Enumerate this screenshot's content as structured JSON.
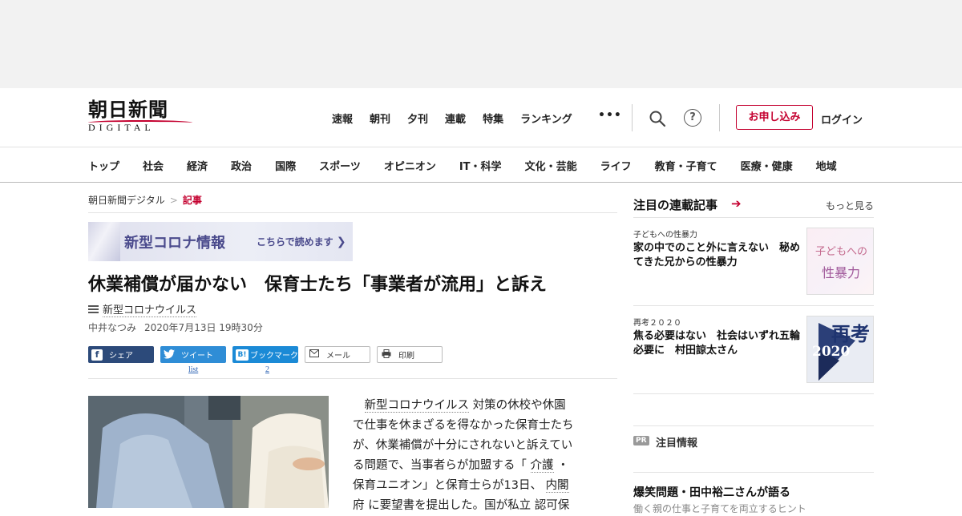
{
  "header": {
    "logo_main": "朝日新聞",
    "logo_sub": "DIGITAL",
    "nav": [
      "速報",
      "朝刊",
      "夕刊",
      "連載",
      "特集",
      "ランキング"
    ],
    "more": "•••",
    "help": "?",
    "apply": "お申し込み",
    "login": "ログイン"
  },
  "categories": [
    "トップ",
    "社会",
    "経済",
    "政治",
    "国際",
    "スポーツ",
    "オピニオン",
    "IT・科学",
    "文化・芸能",
    "ライフ",
    "教育・子育て",
    "医療・健康",
    "地域"
  ],
  "breadcrumb": {
    "home": "朝日新聞デジタル",
    "sep": ">",
    "current": "記事"
  },
  "banner": {
    "title": "新型コロナ情報",
    "link": "こちらで読めます"
  },
  "article": {
    "headline": "休業補償が届かない　保育士たち「事業者が流用」と訴え",
    "tag": "新型コロナウイルス",
    "author": "中井なつみ",
    "date": "2020年7月13日 19時30分",
    "share": {
      "facebook": "シェア",
      "twitter": "ツイート",
      "hatena_icon": "B!",
      "hatena": "ブックマーク",
      "mail": "メール",
      "print": "印刷",
      "twitter_count": "list",
      "hatena_count": "2"
    },
    "body_lines": [
      {
        "pre": "　",
        "u": "新型コロナウイルス",
        "post": " 対策の休校や休園"
      },
      {
        "pre": "で仕事を休まざるを得なかった保育士たち",
        "u": "",
        "post": ""
      },
      {
        "pre": "が、休業補償が十分にされないと訴えてい",
        "u": "",
        "post": ""
      },
      {
        "pre": "る問題で、当事者らが加盟する「 ",
        "u": "介護",
        "post": " ・"
      },
      {
        "pre": "保育ユニオン」と保育士らが13日、 ",
        "u": "内閣",
        "post": ""
      },
      {
        "pre": "府 に要望書を提出した。国が私立 認可保",
        "u": "",
        "post": ""
      }
    ]
  },
  "sidebar": {
    "heading": "注目の連載記事",
    "arrow": "➔",
    "more": "もっと見る",
    "items": [
      {
        "category": "子どもへの性暴力",
        "title": "家の中でのこと外に言えない　秘めてきた兄からの性暴力",
        "thumb_a": "子どもへの",
        "thumb_b": "性暴力"
      },
      {
        "category": "再考２０２０",
        "title": "焦る必要はない　社会はいずれ五輪必要に　村田諒太さん",
        "thumb_a": "再考",
        "thumb_b": "2020"
      }
    ],
    "pr_badge": "PR",
    "pr_label": "注目情報",
    "pr_title": "爆笑問題・田中裕二さんが語る",
    "pr_sub": "働く親の仕事と子育てを両立するヒント"
  },
  "colors": {
    "brand_red": "#c4002f",
    "corona_purple": "#4a4a8c",
    "facebook": "#2c4a7a",
    "twitter": "#2f8dd6"
  }
}
